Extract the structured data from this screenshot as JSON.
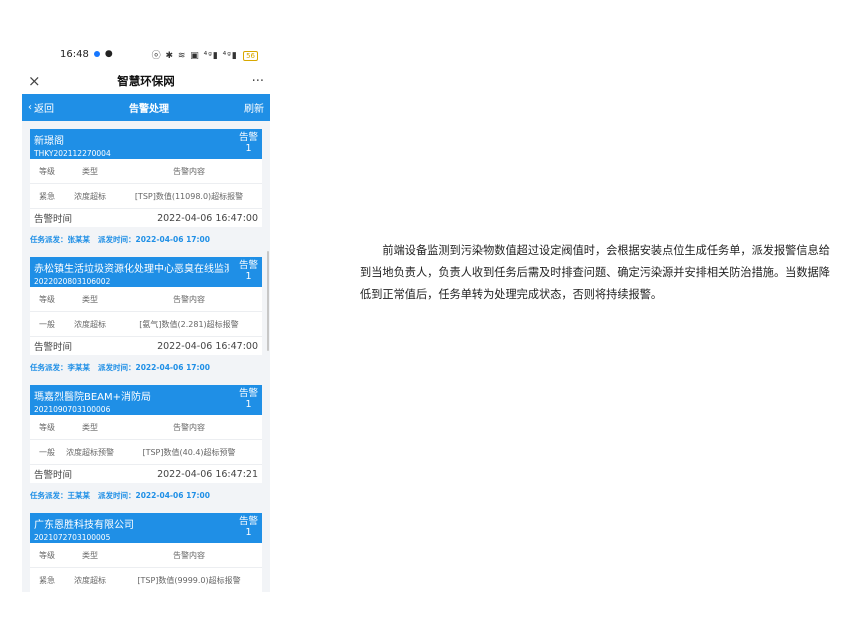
{
  "status_bar": {
    "time": "16:48",
    "icons": "ⓞ ✱ ≋ ▣ ⁴ᵍ▮ ⁴ᵍ▮",
    "battery": "56"
  },
  "title_bar": {
    "close": "×",
    "title": "智慧环保网",
    "more": "···"
  },
  "nav": {
    "back": "返回",
    "title": "告警处理",
    "refresh": "刷新"
  },
  "columns": {
    "level": "等级",
    "type": "类型",
    "content": "告警内容",
    "time_label": "告警时间"
  },
  "alerts": [
    {
      "name": "新璟阁",
      "code": "THKY202112270004",
      "tag": "告警",
      "count": "1",
      "level": "紧急",
      "type": "浓度超标",
      "content": "[TSP]数值(11098.0)超标报警",
      "time": "2022-04-06 16:47:00",
      "dispatcher": "任务派发：张某某",
      "dispatch_time": "派发时间：2022-04-06 17:00"
    },
    {
      "name": "赤松镇生活垃圾资源化处理中心恶臭在线监测",
      "code": "2022020803106002",
      "tag": "告警",
      "count": "1",
      "level": "一般",
      "type": "浓度超标",
      "content": "[氨气]数值(2.281)超标报警",
      "time": "2022-04-06 16:47:00",
      "dispatcher": "任务派发：李某某",
      "dispatch_time": "派发时间：2022-04-06 17:00"
    },
    {
      "name": "瑪嘉烈醫院BEAM+消防局",
      "code": "2021090703100006",
      "tag": "告警",
      "count": "1",
      "level": "一般",
      "type": "浓度超标预警",
      "content": "[TSP]数值(40.4)超标预警",
      "time": "2022-04-06 16:47:21",
      "dispatcher": "任务派发：王某某",
      "dispatch_time": "派发时间：2022-04-06 17:00"
    },
    {
      "name": "广东恩胜科技有限公司",
      "code": "2021072703100005",
      "tag": "告警",
      "count": "1",
      "level": "紧急",
      "type": "浓度超标",
      "content": "[TSP]数值(9999.0)超标报警"
    }
  ],
  "description": "前端设备监测到污染物数值超过设定阀值时，会根据安装点位生成任务单，派发报警信息给到当地负责人，负责人收到任务后需及时排查问题、确定污染源并安排相关防治措施。当数据降低到正常值后，任务单转为处理完成状态，否则将持续报警。"
}
